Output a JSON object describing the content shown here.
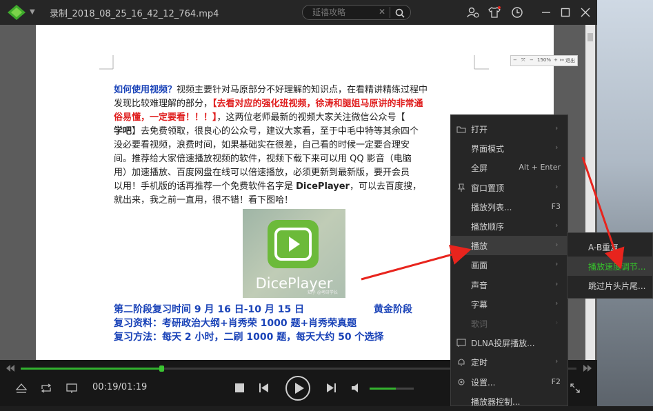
{
  "titlebar": {
    "file_title": "录制_2018_08_25_16_42_12_764.mp4",
    "search_value": "",
    "search_placeholder": "延禧攻略"
  },
  "document": {
    "zoom_label": "150%",
    "exit_label": "退出",
    "paragraph1": [
      [
        {
          "t": "如何使用视频？",
          "c": "blue"
        },
        {
          "t": "视频主要针对马原部分不好理解的知识点，在看精讲精练过程中",
          "c": ""
        }
      ],
      [
        {
          "t": "发现比较难理解的部分，",
          "c": ""
        },
        {
          "t": "【去看对应的强化班视频，徐涛和腿姐马原讲的非常通",
          "c": "red"
        }
      ],
      [
        {
          "t": "俗易懂，一定要看！！！】",
          "c": "red"
        },
        {
          "t": "，这两位老师最新的视频大家关注微信公众号【",
          "c": ""
        }
      ],
      [
        {
          "t": "学吧",
          "c": "b"
        },
        {
          "t": "】去免费领取，很良心的公众号，建议大家看，至于中毛中特等其余四个",
          "c": ""
        }
      ],
      [
        {
          "t": "没必要看视频，浪费时间，如果基础实在很差，自己看的时候一定要合理安",
          "c": ""
        }
      ],
      [
        {
          "t": "间。推荐给大家倍速播放视频的软件，视频下载下来可以用 QQ 影音（电脑",
          "c": ""
        }
      ],
      [
        {
          "t": "用）加速播放、百度网盘在线可以倍速播放，必须更新到最新版，要开会员",
          "c": ""
        }
      ],
      [
        {
          "t": "以用！手机版的话再推荐一个免费软件名字是 ",
          "c": ""
        },
        {
          "t": "DicePlayer",
          "c": "b"
        },
        {
          "t": "，可以去百度搜，",
          "c": ""
        }
      ],
      [
        {
          "t": "就出来，我之前一直用，很不错！看下图哈！",
          "c": ""
        }
      ]
    ],
    "image_caption": "DicePlayer",
    "image_watermark": "知乎 @考研学长",
    "phase_line": "第二阶段复习时间 9 月 16 日-10 月 15 日",
    "phase_name": "黄金阶段",
    "materials_line": "复习资料：考研政治大纲+肖秀荣 1000 题+肖秀荣真题",
    "method_line": "复习方法：每天 2 小时，二刷 1000 题，每天大约 50 个选择"
  },
  "player": {
    "time_display": "00:19/01:19",
    "progress": 0.253,
    "volume": 0.6
  },
  "context_menu": {
    "items": [
      {
        "label": "打开",
        "icon": "folder-icon",
        "arrow": true,
        "shortcut": ""
      },
      {
        "label": "界面模式",
        "icon": "",
        "arrow": true,
        "shortcut": ""
      },
      {
        "label": "全屏",
        "icon": "",
        "arrow": false,
        "shortcut": "Alt + Enter"
      },
      {
        "label": "窗口置顶",
        "icon": "pin-icon",
        "arrow": true,
        "shortcut": ""
      },
      {
        "label": "播放列表...",
        "icon": "",
        "arrow": false,
        "shortcut": "F3"
      },
      {
        "label": "播放顺序",
        "icon": "",
        "arrow": true,
        "shortcut": ""
      },
      {
        "label": "播放",
        "icon": "",
        "arrow": true,
        "shortcut": ""
      },
      {
        "label": "画面",
        "icon": "",
        "arrow": true,
        "shortcut": ""
      },
      {
        "label": "声音",
        "icon": "",
        "arrow": true,
        "shortcut": ""
      },
      {
        "label": "字幕",
        "icon": "",
        "arrow": true,
        "shortcut": ""
      },
      {
        "label": "歌词",
        "icon": "",
        "arrow": true,
        "shortcut": ""
      },
      {
        "label": "DLNA投屏播放...",
        "icon": "cast-icon",
        "arrow": false,
        "shortcut": ""
      },
      {
        "label": "定时",
        "icon": "bell-icon",
        "arrow": true,
        "shortcut": ""
      },
      {
        "label": "设置...",
        "icon": "gear-icon",
        "arrow": false,
        "shortcut": "F2"
      },
      {
        "label": "播放器控制...",
        "icon": "",
        "arrow": false,
        "shortcut": ""
      }
    ]
  },
  "submenu": {
    "items": [
      "A-B重复",
      "播放速度调节...",
      "跳过片头片尾..."
    ]
  },
  "colors": {
    "accent": "#32b22f",
    "annotation_arrow": "#e8241d"
  }
}
